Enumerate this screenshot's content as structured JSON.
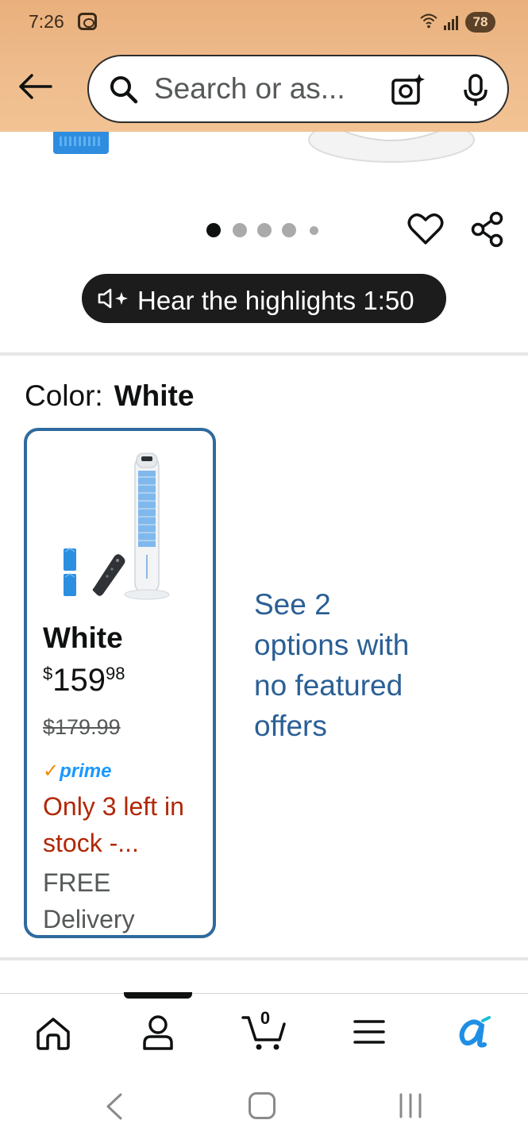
{
  "status_bar": {
    "time": "7:26",
    "battery": "78"
  },
  "search": {
    "placeholder": "Search or as..."
  },
  "carousel": {
    "dot_count": 5,
    "active_index": 0
  },
  "audio": {
    "label": "Hear the highlights 1:50"
  },
  "color_selector": {
    "label": "Color:",
    "selected": "White"
  },
  "variant_card": {
    "title": "White",
    "price_symbol": "$",
    "price_whole": "159",
    "price_fraction": "98",
    "list_price": "$179.99",
    "prime_label": "prime",
    "stock": "Only 3 left in stock -...",
    "free": "FREE",
    "delivery": "Delivery"
  },
  "see_options": "See 2 options with no featured offers",
  "bottom_nav": {
    "cart_count": "0"
  },
  "colors": {
    "header_bg": "#efbd8e",
    "link": "#2a5f95",
    "card_border": "#2e6a9e",
    "stock": "#b12704",
    "prime": "#1a98ff"
  }
}
